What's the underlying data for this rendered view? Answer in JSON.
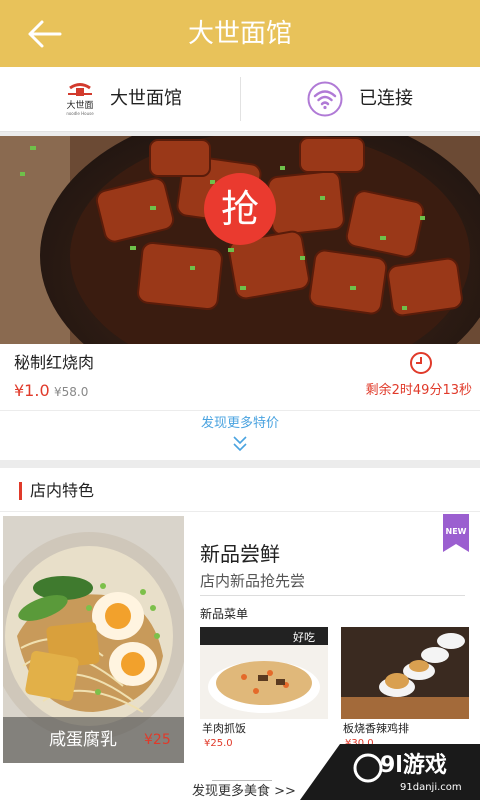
{
  "header": {
    "title": "大世面馆"
  },
  "info_bar": {
    "shop_name": "大世面馆",
    "logo_text": "大世面",
    "logo_sub": "noodle House",
    "wifi_status": "已连接"
  },
  "deal": {
    "name": "秘制红烧肉",
    "price": "¥1.0",
    "original_price": "¥58.0",
    "grab_label": "抢",
    "countdown": "剩余2时49分13秒",
    "more_link": "发现更多特价"
  },
  "section": {
    "title": "店内特色"
  },
  "featured": {
    "name": "咸蛋腐乳",
    "price": "¥25"
  },
  "new_items": {
    "badge": "NEW",
    "title": "新品尝鲜",
    "subtitle": "店内新品抢先尝",
    "label": "新品菜单",
    "items": [
      {
        "name": "羊肉抓饭",
        "price": "¥25.0",
        "img_text": "好吃"
      },
      {
        "name": "板烧香辣鸡排",
        "price": "¥30.0"
      }
    ]
  },
  "footer": {
    "more_link": "发现更多美食 >>"
  },
  "watermark": {
    "main": "9l游戏",
    "sub": "91danji.com"
  },
  "colors": {
    "header": "#e8c25a",
    "accent_red": "#e03a2a",
    "wifi_purple": "#b07ad6",
    "link_blue": "#4aa3e0",
    "badge_purple": "#9b5fd0"
  }
}
